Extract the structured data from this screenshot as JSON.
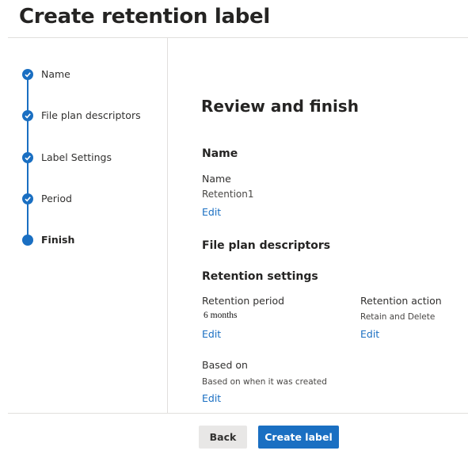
{
  "page_title": "Create retention label",
  "steps": [
    {
      "label": "Name",
      "status": "completed"
    },
    {
      "label": "File plan descriptors",
      "status": "completed"
    },
    {
      "label": "Label Settings",
      "status": "completed"
    },
    {
      "label": "Period",
      "status": "completed"
    },
    {
      "label": "Finish",
      "status": "current"
    }
  ],
  "main": {
    "heading": "Review and finish",
    "name_section": {
      "heading": "Name",
      "field_label": "Name",
      "field_value": "Retention1",
      "edit_label": "Edit"
    },
    "file_plan_section": {
      "heading": "File plan descriptors"
    },
    "retention_section": {
      "heading": "Retention settings",
      "period_label": "Retention period",
      "period_value": "6 months",
      "period_edit": "Edit",
      "action_label": "Retention action",
      "action_value": "Retain and Delete",
      "action_edit": "Edit",
      "based_on_label": "Based on",
      "based_on_value": "Based on when it was created",
      "based_on_edit": "Edit"
    }
  },
  "footer": {
    "back_label": "Back",
    "create_label": "Create label"
  },
  "colors": {
    "accent": "#1a6fc2",
    "divider": "#e1dfdd",
    "secondary_button": "#e8e7e6"
  }
}
